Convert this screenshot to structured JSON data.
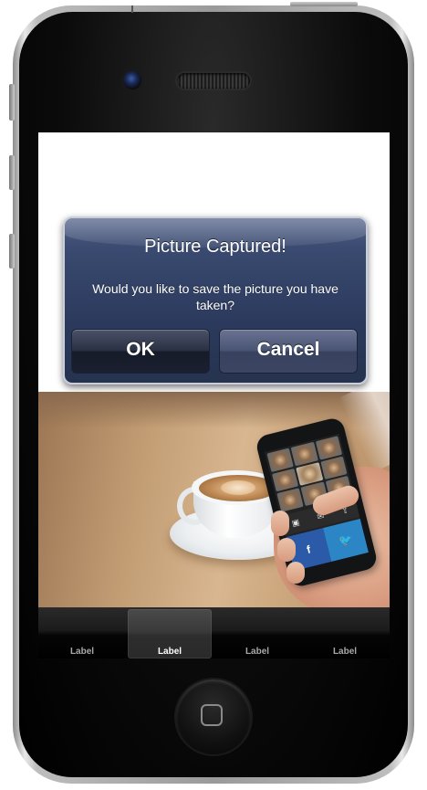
{
  "alert": {
    "title": "Picture Captured!",
    "message": "Would you like to save the picture you have taken?",
    "ok_label": "OK",
    "cancel_label": "Cancel"
  },
  "photo_phone": {
    "facebook_glyph": "f",
    "twitter_glyph": "🐦"
  },
  "tabbar": {
    "items": [
      {
        "label": "Label",
        "selected": false
      },
      {
        "label": "Label",
        "selected": true
      },
      {
        "label": "Label",
        "selected": false
      },
      {
        "label": "Label",
        "selected": false
      }
    ]
  },
  "colors": {
    "alert_bg": "#2c3b5e",
    "tabbar_bg": "#1b1b1b",
    "facebook": "#2a5aa8",
    "twitter": "#2c86c6"
  }
}
